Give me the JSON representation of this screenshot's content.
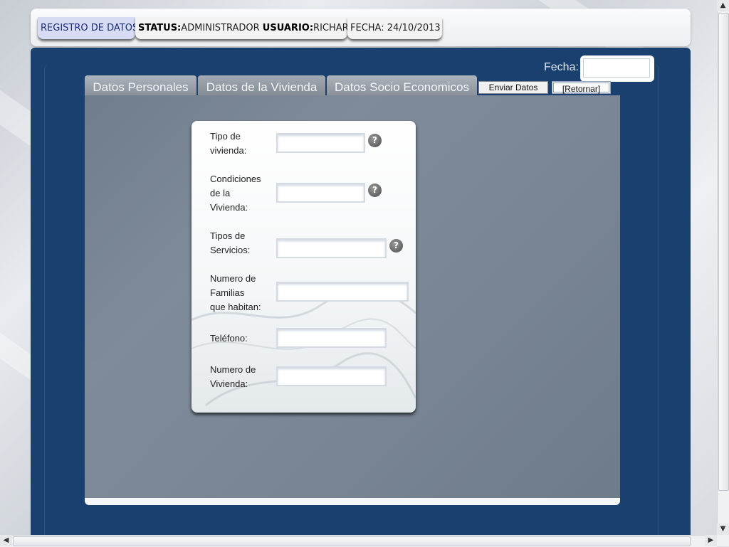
{
  "header": {
    "registro_label": "REGISTRO DE DATOS",
    "status_key": "STATUS:",
    "status_value": "ADMINISTRADOR",
    "usuario_key": "USUARIO:",
    "usuario_value": "RICHARD",
    "fecha_text": "FECHA: 24/10/2013"
  },
  "fecha": {
    "label": "Fecha:",
    "value": ""
  },
  "tabs": [
    {
      "label": "Datos Personales"
    },
    {
      "label": "Datos de la Vivienda"
    },
    {
      "label": "Datos Socio Economicos"
    }
  ],
  "buttons": {
    "enviar": "Enviar Datos",
    "retornar": "[Retornar]"
  },
  "form": {
    "fields": [
      {
        "label_lines": [
          "Tipo de",
          "vivienda:"
        ],
        "value": "",
        "help": "?"
      },
      {
        "label_lines": [
          "Condiciones",
          "de la",
          "Vivienda:"
        ],
        "value": "",
        "help": "?"
      },
      {
        "label_lines": [
          "Tipos de",
          "Servicios:"
        ],
        "value": "",
        "help": "?"
      },
      {
        "label_lines": [
          "Numero de",
          "Familias",
          "que habitan:"
        ],
        "value": ""
      },
      {
        "label_lines": [
          "Teléfono:"
        ],
        "value": ""
      },
      {
        "label_lines": [
          "Numero de",
          "Vivienda:"
        ],
        "value": ""
      }
    ]
  },
  "icons": {
    "help": "question-circle-icon"
  }
}
